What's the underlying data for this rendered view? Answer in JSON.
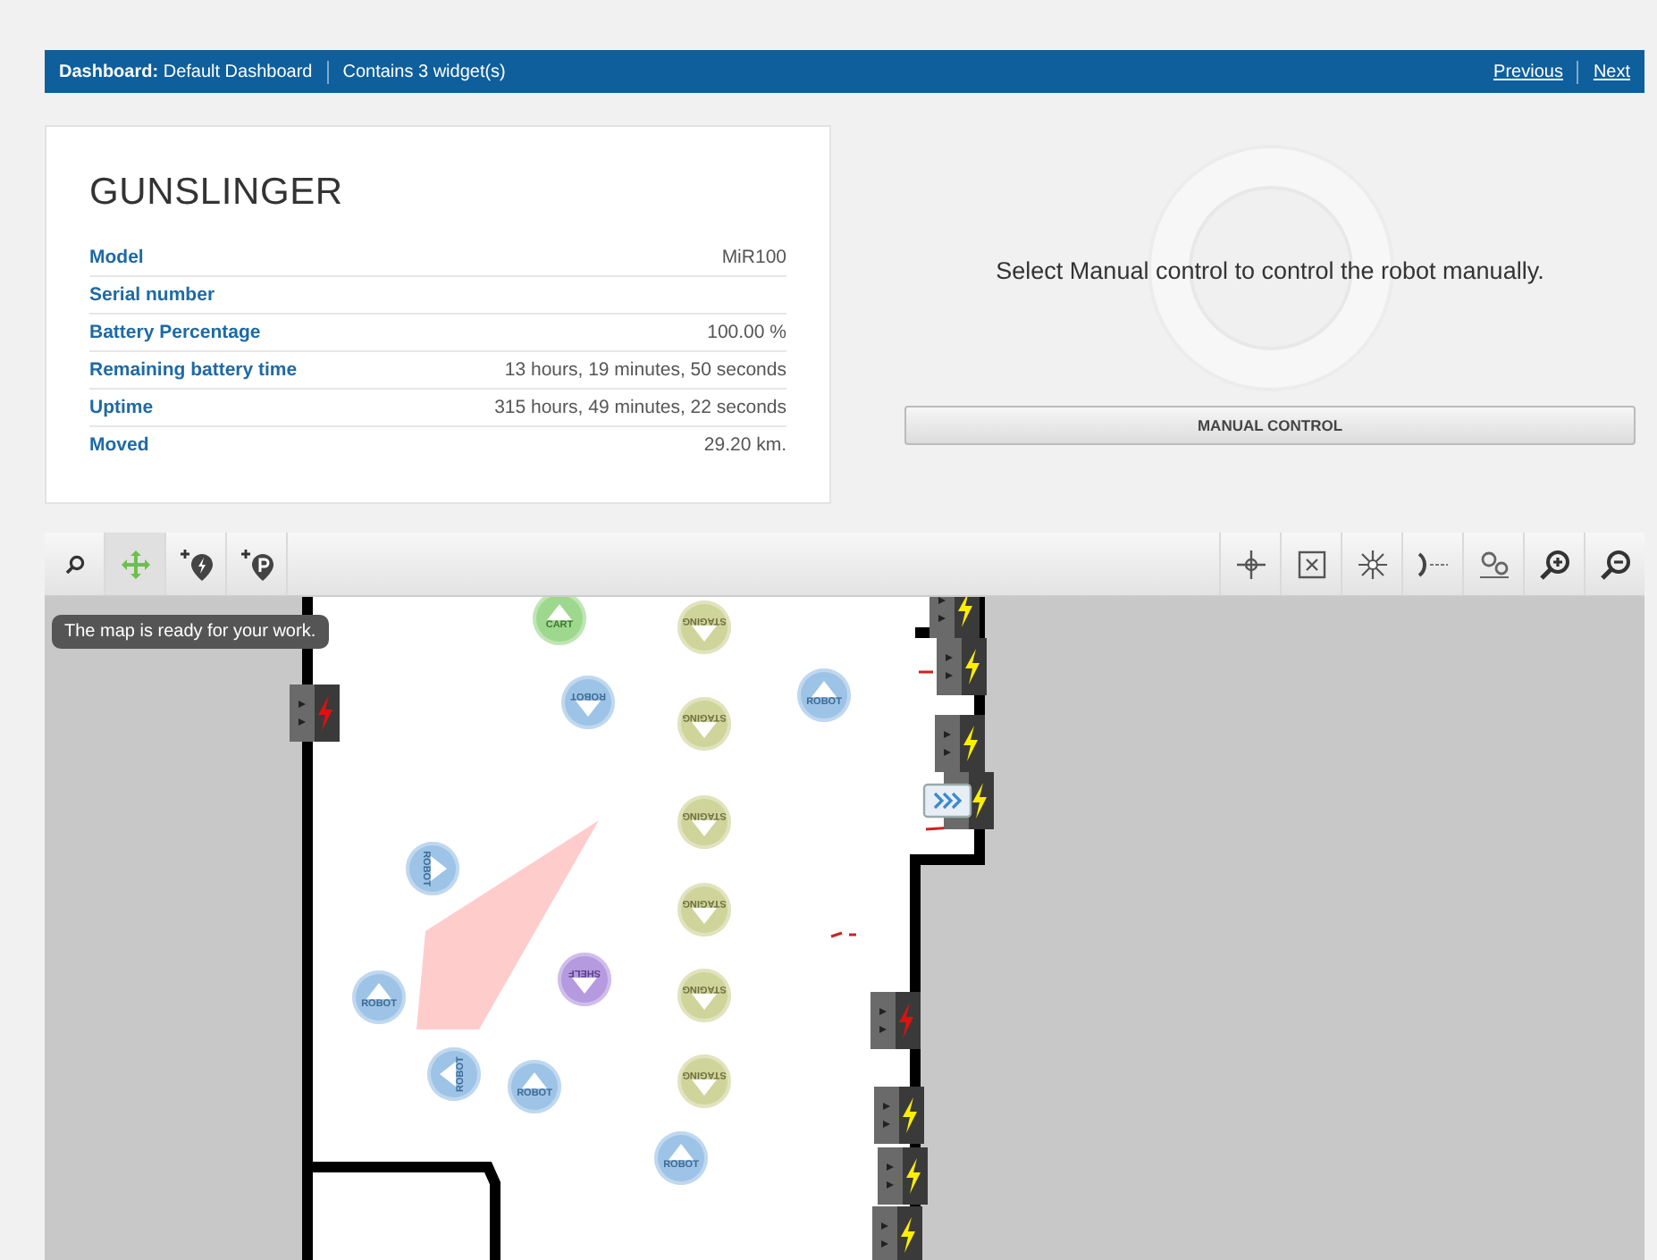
{
  "header": {
    "dashboard_label": "Dashboard:",
    "dashboard_name": "Default Dashboard",
    "widgets": "Contains 3 widget(s)",
    "links": [
      "Previous",
      "Next"
    ]
  },
  "robot": {
    "name": "GUNSLINGER",
    "fields": [
      {
        "label": "Model",
        "value": "MiR100"
      },
      {
        "label": "Serial number"
      },
      {
        "label": "Battery Percentage",
        "value": "100.00 %"
      },
      {
        "label": "Remaining battery time",
        "value": "13 hours, 19 minutes, 50 seconds"
      },
      {
        "label": "Uptime",
        "value": "315 hours, 49 minutes, 22 seconds"
      },
      {
        "label": "Moved",
        "value": "29.20 km."
      }
    ]
  },
  "manual": {
    "message": "Select Manual control to control the robot manually.",
    "button": "MANUAL CONTROL"
  },
  "map_toolbar": {
    "left_tools": [
      {
        "kind": "search",
        "selected": false
      },
      {
        "kind": "move",
        "selected": true
      },
      {
        "kind": "add-charger",
        "selected": false
      },
      {
        "kind": "add-position",
        "selected": false
      }
    ],
    "right_tools": [
      {
        "kind": "crosshair"
      },
      {
        "kind": "fit"
      },
      {
        "kind": "burst"
      },
      {
        "kind": "laser"
      },
      {
        "kind": "pins"
      },
      {
        "kind": "zoom-in"
      },
      {
        "kind": "zoom-out"
      }
    ]
  },
  "map": {
    "tooltip": "The map is ready for your work.",
    "markers": [
      {
        "kind": "cart",
        "label": "CART"
      },
      {
        "kind": "staging",
        "label": "STAGING"
      },
      {
        "kind": "robot",
        "label": "ROBOT"
      },
      {
        "kind": "robot",
        "label": "ROBOT"
      },
      {
        "kind": "staging",
        "label": "STAGING"
      },
      {
        "kind": "staging",
        "label": "STAGING"
      },
      {
        "kind": "robot",
        "label": "ROBOT"
      },
      {
        "kind": "staging",
        "label": "STAGING"
      },
      {
        "kind": "robot",
        "label": "ROBOT"
      },
      {
        "kind": "shelf",
        "label": "SHELF"
      },
      {
        "kind": "staging",
        "label": "STAGING"
      },
      {
        "kind": "robot",
        "label": "ROBOT"
      },
      {
        "kind": "robot",
        "label": "ROBOT"
      },
      {
        "kind": "staging",
        "label": "STAGING"
      },
      {
        "kind": "robot",
        "label": "ROBOT"
      }
    ],
    "chargers": [
      {
        "color": "#ffee00"
      },
      {
        "color": "#ffee00"
      },
      {
        "color": "#ffee00"
      },
      {
        "color": "#ffee00"
      },
      {
        "color": "#e01010"
      },
      {
        "color": "#e01010"
      },
      {
        "color": "#ffee00"
      },
      {
        "color": "#ffee00"
      },
      {
        "color": "#ffee00"
      }
    ]
  }
}
